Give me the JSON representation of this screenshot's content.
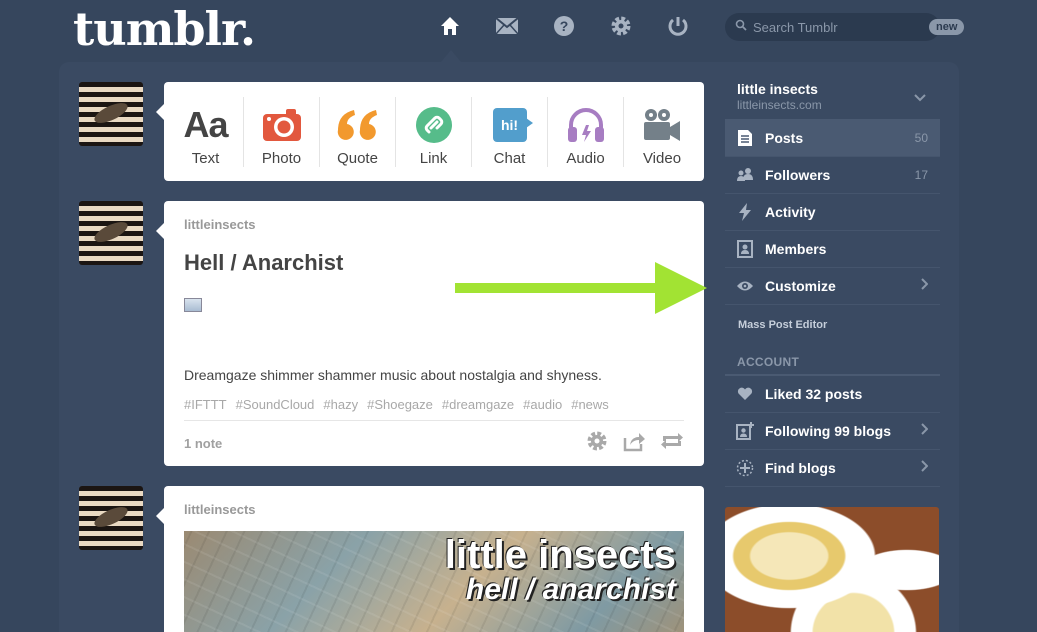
{
  "header": {
    "logo": "tumblr.",
    "nav": [
      {
        "name": "home-icon",
        "active": true
      },
      {
        "name": "mail-icon",
        "active": false
      },
      {
        "name": "help-icon",
        "active": false
      },
      {
        "name": "settings-icon",
        "active": false
      },
      {
        "name": "power-icon",
        "active": false
      }
    ],
    "search": {
      "placeholder": "Search Tumblr",
      "badge": "new"
    }
  },
  "post_types": [
    {
      "label": "Aa",
      "name": "Text"
    },
    {
      "label": "Photo",
      "color": "#e2583e"
    },
    {
      "label": "Quote",
      "color": "#f2992e"
    },
    {
      "label": "Link",
      "color": "#56bc8a"
    },
    {
      "label": "Chat",
      "color": "#529ecc"
    },
    {
      "label": "Audio",
      "color": "#a77dc2"
    },
    {
      "label": "Video",
      "color": "#748089"
    }
  ],
  "post_types_labels": {
    "text": "Text",
    "text_glyph": "Aa",
    "photo": "Photo",
    "quote": "Quote",
    "link": "Link",
    "chat": "Chat",
    "chat_glyph": "hi!",
    "audio": "Audio",
    "video": "Video"
  },
  "posts": [
    {
      "blog": "littleinsects",
      "title": "Hell / Anarchist",
      "body": "Dreamgaze shimmer shammer music about nostalgia and shyness.",
      "tags": [
        "#IFTTT",
        "#SoundCloud",
        "#hazy",
        "#Shoegaze",
        "#dreamgaze",
        "#audio",
        "#news"
      ],
      "notes": "1 note"
    },
    {
      "blog": "littleinsects",
      "image_title": "little insects",
      "image_subtitle": "hell / anarchist"
    }
  ],
  "sidebar": {
    "blog_name": "little insects",
    "blog_url": "littleinsects.com",
    "items": [
      {
        "label": "Posts",
        "count": "50",
        "icon": "posts-icon",
        "active": true
      },
      {
        "label": "Followers",
        "count": "17",
        "icon": "followers-icon"
      },
      {
        "label": "Activity",
        "count": "",
        "icon": "activity-icon"
      },
      {
        "label": "Members",
        "count": "",
        "icon": "members-icon"
      },
      {
        "label": "Customize",
        "count": "",
        "icon": "eye-icon",
        "chevron": true
      }
    ],
    "mass_editor": "Mass Post Editor",
    "account_label": "ACCOUNT",
    "account_items": [
      {
        "label": "Liked 32 posts",
        "icon": "heart-icon"
      },
      {
        "label": "Following 99 blogs",
        "icon": "following-icon",
        "chevron": true
      },
      {
        "label": "Find blogs",
        "icon": "find-icon",
        "chevron": true
      }
    ]
  },
  "colors": {
    "background": "#36465d",
    "arrow": "#a2e333"
  }
}
